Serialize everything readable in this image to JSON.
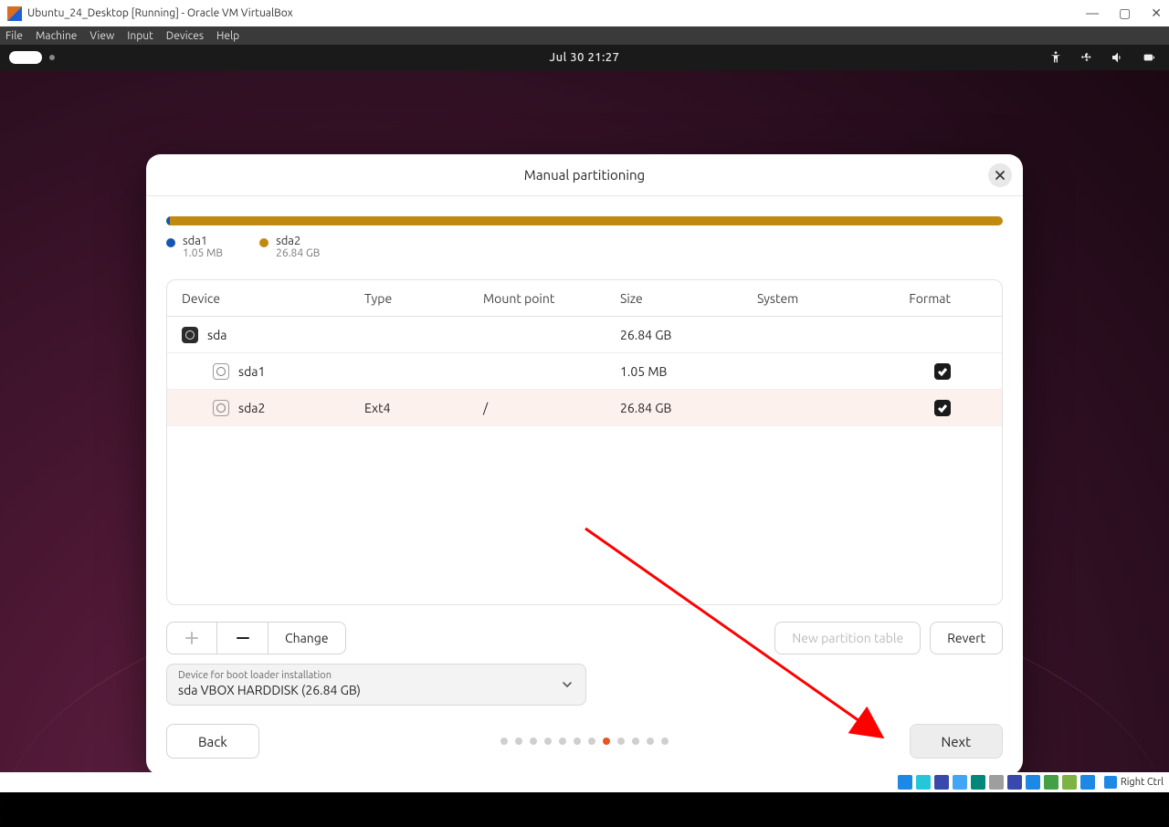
{
  "vbox": {
    "title": "Ubuntu_24_Desktop [Running] - Oracle VM VirtualBox",
    "menus": [
      "File",
      "Machine",
      "View",
      "Input",
      "Devices",
      "Help"
    ],
    "right_ctrl": "Right Ctrl"
  },
  "topbar": {
    "clock": "Jul 30  21:27"
  },
  "dialog": {
    "title": "Manual partitioning",
    "legend": [
      {
        "name": "sda1",
        "size": "1.05 MB",
        "color": "#1557b0"
      },
      {
        "name": "sda2",
        "size": "26.84 GB",
        "color": "#c08a12"
      }
    ],
    "columns": {
      "device": "Device",
      "type": "Type",
      "mount": "Mount point",
      "size": "Size",
      "system": "System",
      "format": "Format"
    },
    "rows": [
      {
        "device": "sda",
        "type": "",
        "mount": "",
        "size": "26.84 GB",
        "system": "",
        "format": null,
        "icon": "disk",
        "indent": 0
      },
      {
        "device": "sda1",
        "type": "",
        "mount": "",
        "size": "1.05 MB",
        "system": "",
        "format": true,
        "icon": "part",
        "indent": 1
      },
      {
        "device": "sda2",
        "type": "Ext4",
        "mount": "/",
        "size": "26.84 GB",
        "system": "",
        "format": true,
        "icon": "part",
        "indent": 1,
        "selected": true
      }
    ],
    "buttons": {
      "change": "Change",
      "new_table": "New partition table",
      "revert": "Revert"
    },
    "boot": {
      "label": "Device for boot loader installation",
      "value": "sda VBOX HARDDISK (26.84 GB)"
    },
    "nav": {
      "back": "Back",
      "next": "Next"
    },
    "steps": {
      "total": 12,
      "active": 8
    }
  }
}
